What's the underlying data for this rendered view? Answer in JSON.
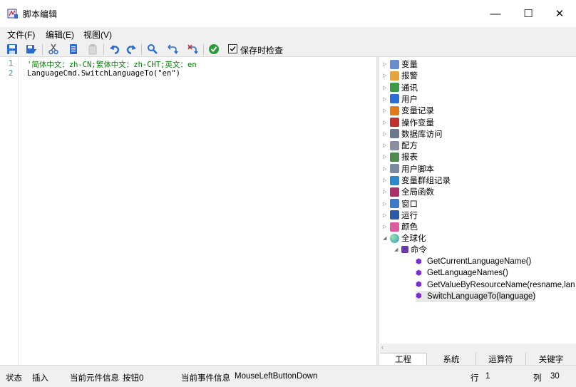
{
  "window": {
    "title": "脚本编辑",
    "minimize": "—",
    "maximize": "☐",
    "close": "✕"
  },
  "menu": [
    "文件(F)",
    "编辑(E)",
    "视图(V)"
  ],
  "toolbar": {
    "icons": [
      "save-icon",
      "save-as-icon",
      "cut-icon",
      "copy-icon",
      "paste-icon",
      "undo-icon",
      "redo-icon",
      "find-icon",
      "replace-icon",
      "replace-all-icon",
      "check-icon"
    ],
    "check_on_save_label": "保存时检查",
    "check_on_save_checked": true
  },
  "editor": {
    "line_numbers": [
      "1",
      "2"
    ],
    "lines": [
      "'简体中文：zh-CN;繁体中文：zh-CHT;英文：en",
      "LanguageCmd.SwitchLanguageTo(\"en\")"
    ],
    "comment_color": "#008000"
  },
  "tree": {
    "categories": [
      {
        "label": "变量",
        "color": "#6a8ccc"
      },
      {
        "label": "报警",
        "color": "#e8a33a"
      },
      {
        "label": "通讯",
        "color": "#3a9a4a"
      },
      {
        "label": "用户",
        "color": "#2b6fd6"
      },
      {
        "label": "变量记录",
        "color": "#e07a1a"
      },
      {
        "label": "操作变量",
        "color": "#c03030"
      },
      {
        "label": "数据库访问",
        "color": "#6a7a8a"
      },
      {
        "label": "配方",
        "color": "#8a8fa0"
      },
      {
        "label": "报表",
        "color": "#4f8a4f"
      },
      {
        "label": "用户脚本",
        "color": "#7a8aa0"
      },
      {
        "label": "变量群组记录",
        "color": "#2a88cc"
      },
      {
        "label": "全局函数",
        "color": "#b0306a"
      },
      {
        "label": "窗口",
        "color": "#3a7ac8"
      },
      {
        "label": "运行",
        "color": "#2a5aa8"
      },
      {
        "label": "颜色",
        "color": "#e05aa0"
      }
    ],
    "expanded": {
      "label": "全球化",
      "color": "#3a9ad8"
    },
    "command_group": {
      "label": "命令",
      "color": "#6a3aa8"
    },
    "commands": [
      "GetCurrentLanguageName()",
      "GetLanguageNames()",
      "GetValueByResourceName(resname,lan",
      "SwitchLanguageTo(language)"
    ],
    "selected_command_index": 3
  },
  "tabs": [
    "工程",
    "系统",
    "运算符",
    "关键字"
  ],
  "active_tab_index": 0,
  "status": {
    "state_label": "状态",
    "state_value": "插入",
    "element_label": "当前元件信息",
    "element_value": "按钮0",
    "event_label": "当前事件信息",
    "event_value": "MouseLeftButtonDown",
    "row_label": "行",
    "row_value": "1",
    "col_label": "列",
    "col_value": "30"
  }
}
